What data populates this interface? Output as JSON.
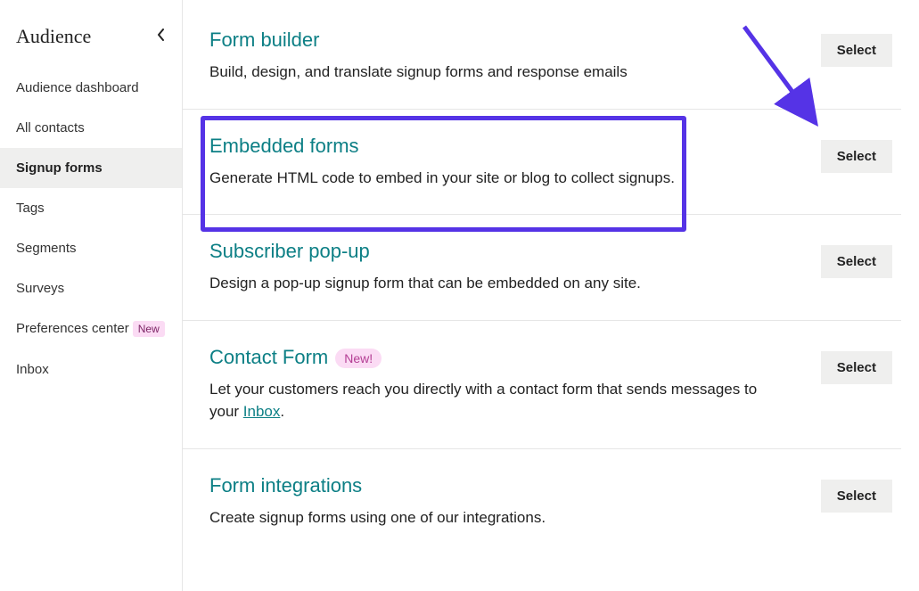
{
  "sidebar": {
    "title": "Audience",
    "items": [
      {
        "label": "Audience dashboard",
        "active": false,
        "badge": null
      },
      {
        "label": "All contacts",
        "active": false,
        "badge": null
      },
      {
        "label": "Signup forms",
        "active": true,
        "badge": null
      },
      {
        "label": "Tags",
        "active": false,
        "badge": null
      },
      {
        "label": "Segments",
        "active": false,
        "badge": null
      },
      {
        "label": "Surveys",
        "active": false,
        "badge": null
      },
      {
        "label": "Preferences center",
        "active": false,
        "badge": "New"
      },
      {
        "label": "Inbox",
        "active": false,
        "badge": null
      }
    ]
  },
  "buttons": {
    "select": "Select"
  },
  "forms": [
    {
      "title": "Form builder",
      "desc": "Build, design, and translate signup forms and response emails"
    },
    {
      "title": "Embedded forms",
      "desc": "Generate HTML code to embed in your site or blog to collect signups."
    },
    {
      "title": "Subscriber pop-up",
      "desc": "Design a pop-up signup form that can be embedded on any site."
    },
    {
      "title": "Contact Form",
      "pill": "New!",
      "desc_pre": "Let your customers reach you directly with a contact form that sends messages to your ",
      "link": "Inbox",
      "desc_post": "."
    },
    {
      "title": "Form integrations",
      "desc": "Create signup forms using one of our integrations."
    }
  ]
}
